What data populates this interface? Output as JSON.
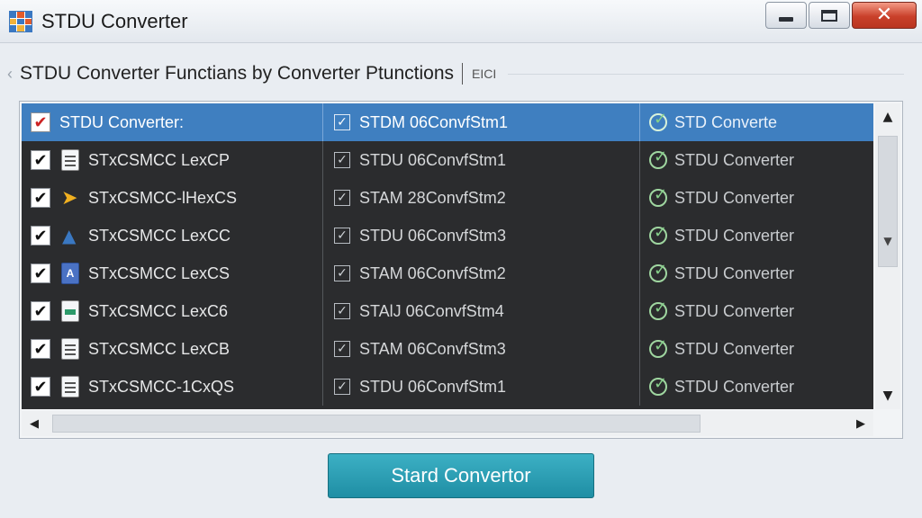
{
  "window": {
    "title": "STDU Converter",
    "close_glyph": "✕"
  },
  "header": {
    "subtitle": "STDU Converter Functians by Converter Ptunctions",
    "extra": "EICI"
  },
  "list": {
    "rows": [
      {
        "name": "STDU Converter:",
        "icon": "checkbox-icon",
        "col2": "STDM 06ConvfStm1",
        "col3": "STD Converte",
        "selected": true
      },
      {
        "name": "STxCSMCC LexCP",
        "icon": "document-icon",
        "col2": "STDU 06ConvfStm1",
        "col3": "STDU Converter"
      },
      {
        "name": "STxCSMCC-lHexCS",
        "icon": "arrow-file-icon",
        "col2": "STAM 28ConvfStm2",
        "col3": "STDU Converter"
      },
      {
        "name": "STxCSMCC LexCC",
        "icon": "pdf-icon",
        "col2": "STDU 06ConvfStm3",
        "col3": "STDU Converter"
      },
      {
        "name": "STxCSMCC LexCS",
        "icon": "a-file-icon",
        "col2": "STAM 06ConvfStm2",
        "col3": "STDU Converter"
      },
      {
        "name": "STxCSMCC LexC6",
        "icon": "green-file-icon",
        "col2": "STAlJ 06ConvfStm4",
        "col3": "STDU Converter"
      },
      {
        "name": "STxCSMCC LexCB",
        "icon": "document-icon",
        "col2": "STAM 06ConvfStm3",
        "col3": "STDU Converter"
      },
      {
        "name": "STxCSMCC-1CxQS",
        "icon": "document-icon",
        "col2": "STDU 06ConvfStm1",
        "col3": "STDU Converter"
      }
    ]
  },
  "scroll": {
    "up": "▲",
    "down": "▼",
    "left": "◀",
    "right": "▶"
  },
  "actions": {
    "start_label": "Stard Convertor"
  },
  "colors": {
    "selection": "#3f7fc0",
    "grid_bg": "#2b2c2e",
    "button": "#2aa0b6",
    "close": "#c9402a"
  }
}
